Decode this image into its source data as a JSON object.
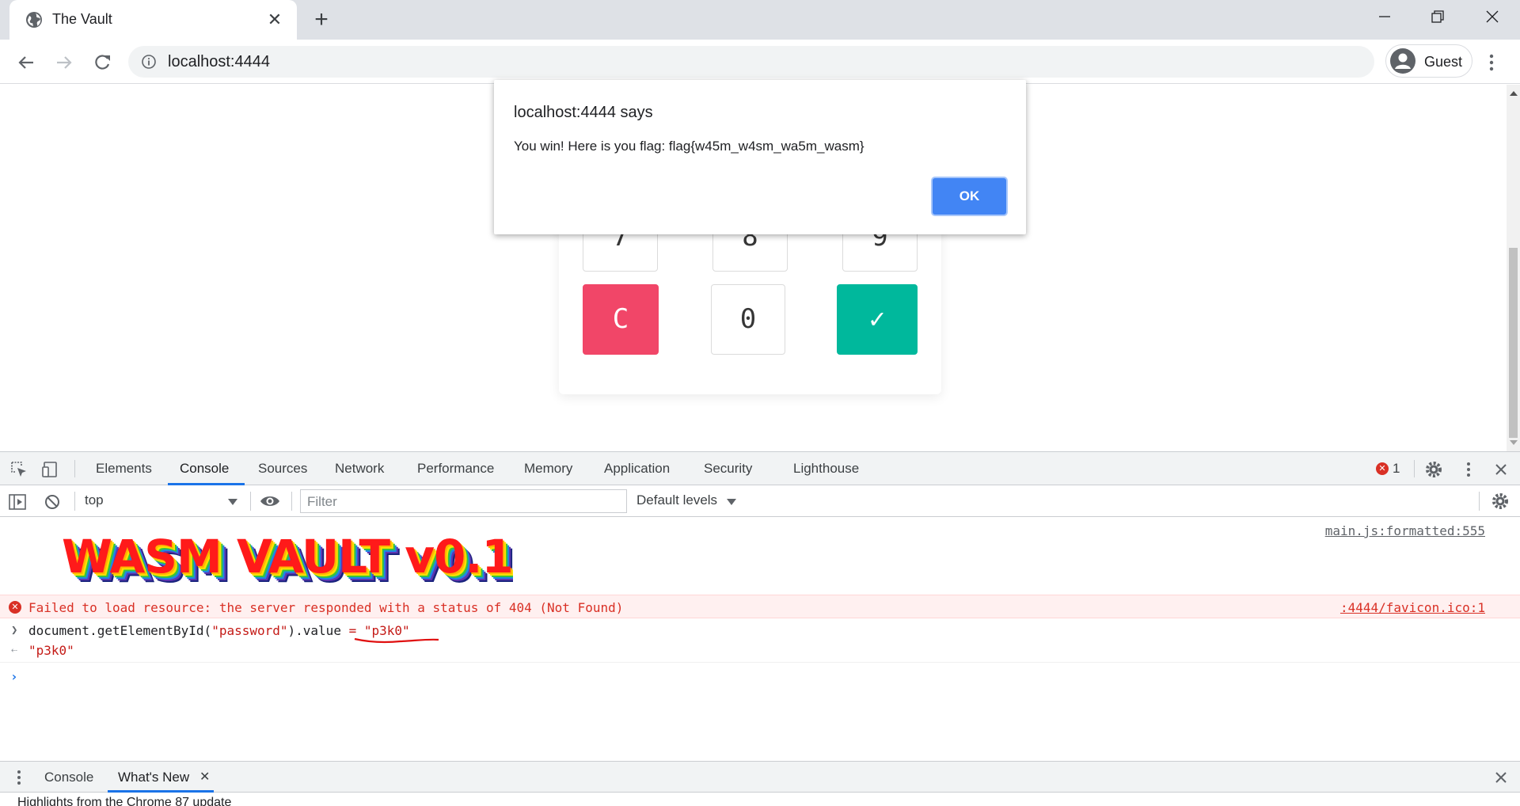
{
  "browser": {
    "tab_title": "The Vault",
    "url": "localhost:4444",
    "profile_name": "Guest"
  },
  "vault": {
    "keys_row3": [
      "7",
      "8",
      "9"
    ],
    "clear_label": "C",
    "zero_label": "0",
    "submit_label": "✓",
    "colors": {
      "clear": "#f14668",
      "submit": "#00b89c"
    }
  },
  "alert": {
    "origin": "localhost:4444 says",
    "message": "You win! Here is you flag: flag{w45m_w4sm_wa5m_wasm}",
    "ok_label": "OK"
  },
  "devtools": {
    "tabs": [
      "Elements",
      "Console",
      "Sources",
      "Network",
      "Performance",
      "Memory",
      "Application",
      "Security",
      "Lighthouse"
    ],
    "active_tab": "Console",
    "error_count": "1",
    "context": "top",
    "filter_placeholder": "Filter",
    "levels": "Default levels",
    "banner_text": "WASM VAULT v0.1",
    "banner_source": "main.js:formatted:555",
    "error_message": "Failed to load resource: the server responded with a status of 404 (Not Found)",
    "error_source": ":4444/favicon.ico:1",
    "command_prefix": "document.getElementById(",
    "command_arg": "\"password\"",
    "command_suffix": ").value ",
    "command_assign": "= \"p3k0\"",
    "command_result": "\"p3k0\"",
    "drawer_tabs": [
      "Console",
      "What's New"
    ],
    "drawer_active": "What's New",
    "drawer_footer_text": "Highlights from the Chrome 87 update"
  }
}
